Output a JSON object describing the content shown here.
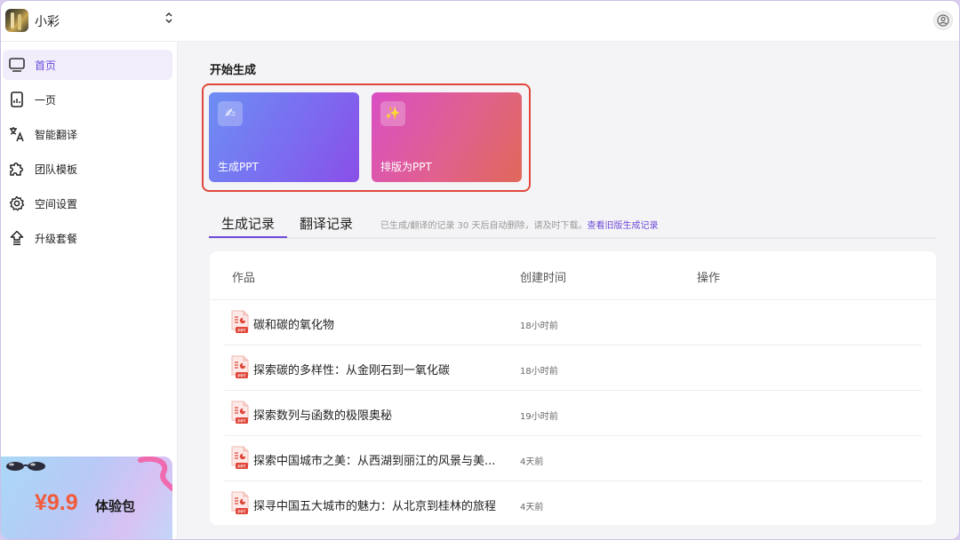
{
  "topbar": {
    "workspace_name": "小彩",
    "switch_glyph": "⌃⌄"
  },
  "sidebar": {
    "items": [
      {
        "label": "首页",
        "icon": "monitor-icon",
        "active": true
      },
      {
        "label": "一页",
        "icon": "document-chart-icon",
        "active": false
      },
      {
        "label": "智能翻译",
        "icon": "translate-icon",
        "active": false
      },
      {
        "label": "团队模板",
        "icon": "puzzle-icon",
        "active": false
      },
      {
        "label": "空间设置",
        "icon": "gear-icon",
        "active": false
      },
      {
        "label": "升级套餐",
        "icon": "upgrade-icon",
        "active": false
      }
    ],
    "promo": {
      "price": "¥9.9",
      "label": "体验包"
    }
  },
  "main": {
    "section_title": "开始生成",
    "cards": [
      {
        "label": "生成PPT",
        "icon": "pen-icon",
        "glyph": "✍"
      },
      {
        "label": "排版为PPT",
        "icon": "sparkle-icon",
        "glyph": "✨"
      }
    ],
    "tabs": [
      {
        "label": "生成记录",
        "active": true
      },
      {
        "label": "翻译记录",
        "active": false
      }
    ],
    "notice_text": "已生成/翻译的记录 30 天后自动删除，请及时下载。",
    "notice_link": "查看旧版生成记录",
    "table": {
      "headers": [
        "作品",
        "创建时间",
        "操作"
      ],
      "rows": [
        {
          "title": "碳和碳的氧化物",
          "time": "18小时前"
        },
        {
          "title": "探索碳的多样性：从金刚石到一氧化碳",
          "time": "18小时前"
        },
        {
          "title": "探索数列与函数的极限奥秘",
          "time": "19小时前"
        },
        {
          "title": "探索中国城市之美：从西湖到丽江的风景与美...",
          "time": "4天前"
        },
        {
          "title": "探寻中国五大城市的魅力：从北京到桂林的旅程",
          "time": "4天前"
        }
      ],
      "file_badge": "PPT"
    }
  },
  "colors": {
    "accent": "#6d4bd9",
    "highlight": "#e0473a",
    "card1": "#7b6cf0",
    "card2": "#e0618e"
  }
}
